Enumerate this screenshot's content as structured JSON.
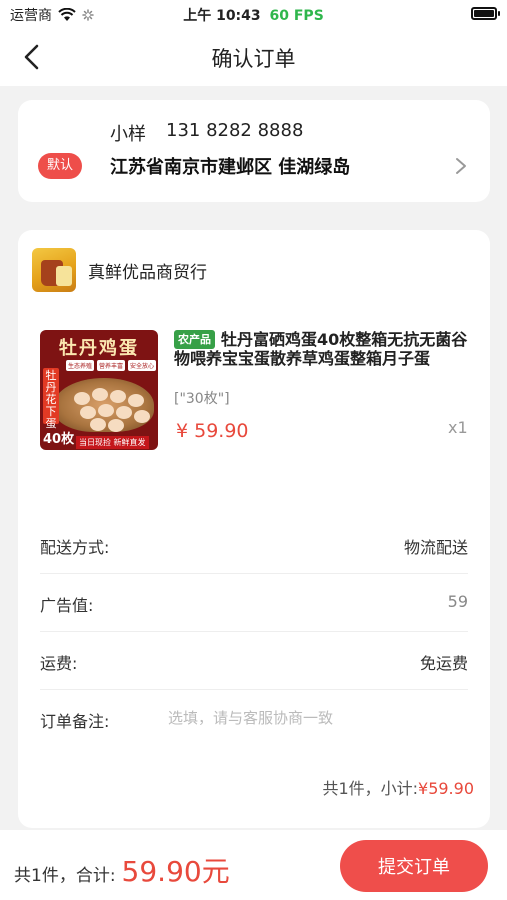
{
  "status_bar": {
    "carrier": "运营商",
    "time": "上午 10:43",
    "fps": "60 FPS"
  },
  "nav": {
    "title": "确认订单",
    "back_icon": "chevron-left-icon"
  },
  "address": {
    "name": "小样",
    "phone": "131 8282 8888",
    "default_label": "默认",
    "full_address": "江苏省南京市建邺区 佳湖绿岛",
    "chevron_icon": "chevron-right-icon"
  },
  "shop": {
    "name": "真鲜优品商贸行"
  },
  "product": {
    "image_title": "牡丹鸡蛋",
    "image_tags": [
      "生态养殖",
      "营养丰富",
      "安全放心"
    ],
    "image_side_label": "牡丹花下蛋",
    "image_count": "40枚",
    "image_footer": "当日现捡 新鲜直发",
    "farm_badge": "农产品",
    "title": "牡丹富硒鸡蛋40枚整箱无抗无菌谷物喂养宝宝蛋散养草鸡蛋整箱月子蛋",
    "spec": "[\"30枚\"]",
    "price": "¥ 59.90",
    "quantity": "x1"
  },
  "details": {
    "delivery_label": "配送方式:",
    "delivery_value": "物流配送",
    "ad_label": "广告值:",
    "ad_value": "59",
    "shipping_label": "运费:",
    "shipping_value": "免运费",
    "note_label": "订单备注:",
    "note_placeholder": "选填，请与客服协商一致"
  },
  "subtotal": {
    "label": "共1件，小计:",
    "amount": "¥59.90"
  },
  "footer": {
    "total_label": "共1件，合计:",
    "total_amount": "59.90元",
    "submit_label": "提交订单"
  },
  "colors": {
    "accent": "#ef4e4b",
    "price": "#e8493c",
    "background": "#f2f2f2"
  }
}
